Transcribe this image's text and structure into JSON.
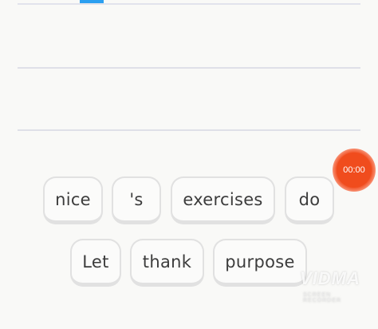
{
  "answer_area": {
    "lines": 2
  },
  "word_bank": {
    "row1": [
      "nice",
      "'s",
      "exercises",
      "do"
    ],
    "row2": [
      "Let",
      "thank",
      "purpose"
    ]
  },
  "recorder": {
    "time": "00:00",
    "color": "#f04c1d"
  },
  "watermark": {
    "brand": "VIDMA",
    "subtitle": "SCREEN RECORDER"
  }
}
